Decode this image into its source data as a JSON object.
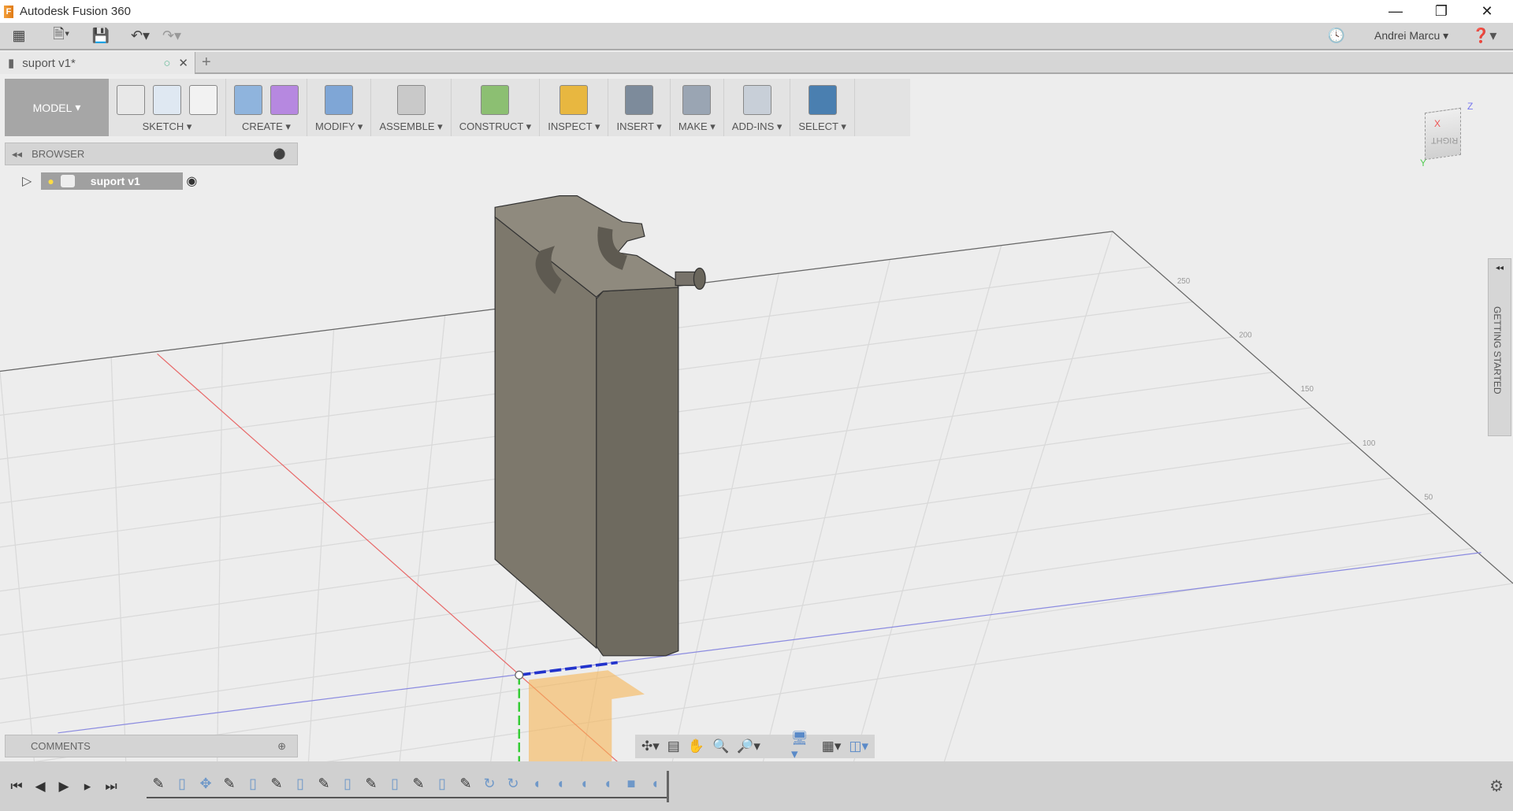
{
  "app": {
    "title": "Autodesk Fusion 360",
    "user": "Andrei Marcu"
  },
  "tab": {
    "label": "suport v1*"
  },
  "toolbar": {
    "mode": "MODEL",
    "groups": [
      {
        "label": "SKETCH",
        "icons": [
          "sketch-create",
          "arc",
          "rectangle"
        ]
      },
      {
        "label": "CREATE",
        "icons": [
          "extrude",
          "form"
        ]
      },
      {
        "label": "MODIFY",
        "icons": [
          "press-pull"
        ]
      },
      {
        "label": "ASSEMBLE",
        "icons": [
          "joint"
        ]
      },
      {
        "label": "CONSTRUCT",
        "icons": [
          "plane"
        ]
      },
      {
        "label": "INSPECT",
        "icons": [
          "measure"
        ]
      },
      {
        "label": "INSERT",
        "icons": [
          "image"
        ]
      },
      {
        "label": "MAKE",
        "icons": [
          "3d-print"
        ]
      },
      {
        "label": "ADD-INS",
        "icons": [
          "scripts"
        ]
      },
      {
        "label": "SELECT",
        "icons": [
          "select"
        ]
      }
    ]
  },
  "browser": {
    "title": "BROWSER",
    "root": "suport v1"
  },
  "comments": {
    "title": "COMMENTS"
  },
  "getting_started": {
    "label": "GETTING STARTED"
  },
  "viewcube": {
    "face": "RIGHT",
    "axes": [
      "X",
      "Y",
      "Z"
    ]
  },
  "grid_ticks": [
    "250",
    "200",
    "150",
    "100",
    "50"
  ],
  "timeline": [
    "sketch",
    "extrude",
    "move",
    "sketch",
    "extrude",
    "sketch",
    "extrude",
    "sketch",
    "extrude",
    "sketch",
    "extrude",
    "sketch",
    "extrude",
    "sketch",
    "revolve",
    "revolve",
    "fillet",
    "fillet",
    "fillet",
    "fillet",
    "box",
    "fillet"
  ],
  "colors": {
    "accent": "#4a7fb0",
    "body": "#7d786c"
  }
}
